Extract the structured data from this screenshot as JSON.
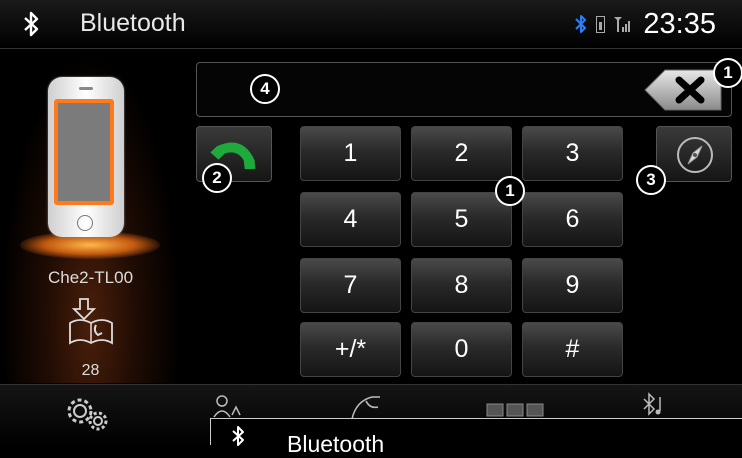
{
  "header": {
    "title": "Bluetooth",
    "clock": "23:35",
    "icons": [
      "bluetooth-icon",
      "battery-icon",
      "signal-icon"
    ]
  },
  "device": {
    "name": "Che2-TL00",
    "phonebook_count": "28"
  },
  "number_field": {
    "value": ""
  },
  "keypad": [
    "1",
    "2",
    "3",
    "4",
    "5",
    "6",
    "7",
    "8",
    "9",
    "+/*",
    "0",
    "#"
  ],
  "callouts": {
    "backspace": "1",
    "keypad": "1",
    "call": "2",
    "navigation": "3",
    "number_field": "4"
  },
  "popup": {
    "title": "Bluetooth"
  },
  "colors": {
    "accent": "#ff7a1a",
    "call_green": "#1faa3c",
    "bluetooth_blue": "#2a7fff"
  }
}
